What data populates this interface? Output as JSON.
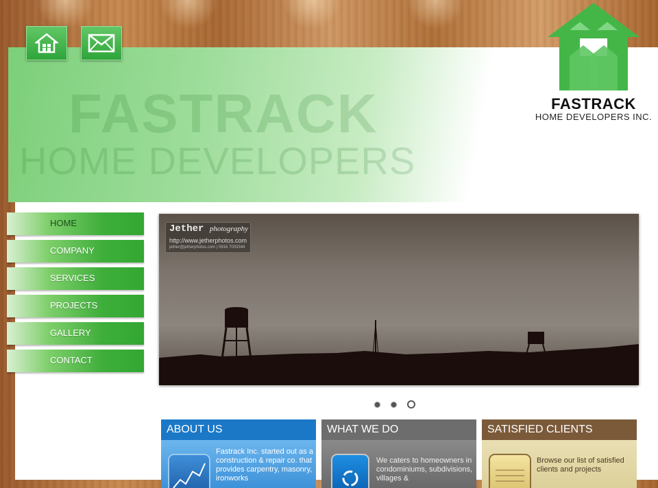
{
  "logo": {
    "name": "FASTRACK",
    "sub": "HOME DEVELOPERS INC."
  },
  "banner": {
    "ghost_title": "FASTRACK",
    "ghost_sub": "HOME DEVELOPERS"
  },
  "nav": {
    "items": [
      {
        "label": "HOME",
        "active": true
      },
      {
        "label": "COMPANY"
      },
      {
        "label": "SERVICES"
      },
      {
        "label": "PROJECTS"
      },
      {
        "label": "GALLERY"
      },
      {
        "label": "CONTACT"
      }
    ]
  },
  "slider": {
    "watermark_title": "Jether",
    "watermark_italic": "photography",
    "watermark_url": "http://www.jetherphotos.com",
    "watermark_contact": "jether@jetherphotos.com | 0916 7003344",
    "active_index": 2
  },
  "boxes": [
    {
      "title": "ABOUT US",
      "text": "Fastrack Inc. started out as a construction & repair co. that provides carpentry, masonry, ironworks"
    },
    {
      "title": "WHAT WE DO",
      "text": "We caters to homeowners in condominiums, subdivisions, villages &"
    },
    {
      "title": "SATISFIED CLIENTS",
      "text": "Browse our list of satisfied clients and projects"
    }
  ],
  "colors": {
    "accent_green": "#3eae3a",
    "blue": "#1b78c7",
    "gray": "#6d6d6d",
    "brown": "#7b5a3a"
  }
}
